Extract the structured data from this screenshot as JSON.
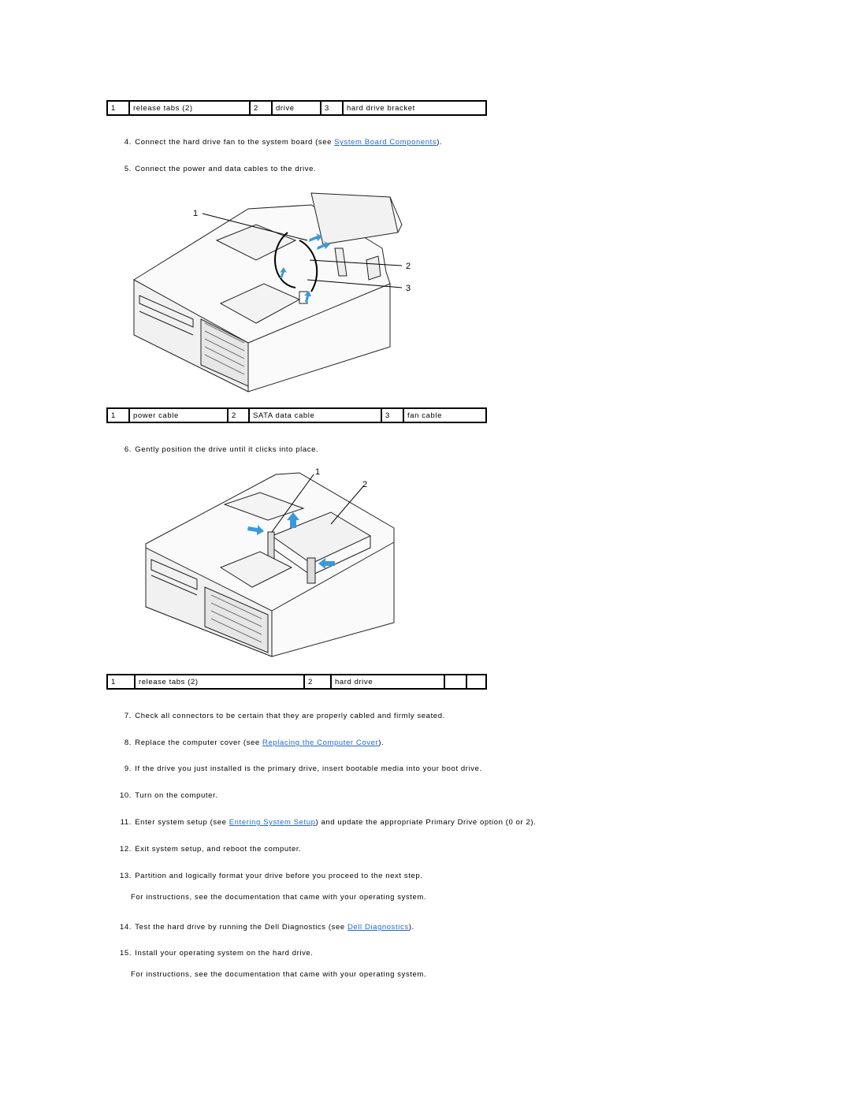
{
  "tables": [
    {
      "rows": [
        [
          "1",
          "release tabs (2)",
          "2",
          "drive",
          "3",
          "hard drive bracket"
        ]
      ]
    },
    {
      "rows": [
        [
          "1",
          "power cable",
          "2",
          "SATA data cable",
          "3",
          "fan cable"
        ]
      ]
    },
    {
      "rows": [
        [
          "1",
          "release tabs (2)",
          "2",
          "hard drive",
          "",
          ""
        ]
      ]
    }
  ],
  "steps": [
    {
      "num": "4.",
      "before": "Connect the hard drive fan to the system board (see ",
      "link": "System Board Components",
      "after": ")."
    },
    {
      "num": "5.",
      "text": "Connect the power and data cables to the drive."
    },
    {
      "num": "6.",
      "text": "Gently position the drive until it clicks into place."
    },
    {
      "num": "7.",
      "text": "Check all connectors to be certain that they are properly cabled and firmly seated."
    },
    {
      "num": "8.",
      "before": "Replace the computer cover (see ",
      "link": "Replacing the Computer Cover",
      "after": ")."
    },
    {
      "num": "9.",
      "text": "If the drive you just installed is the primary drive, insert bootable media into your boot drive."
    },
    {
      "num": "10.",
      "text": "Turn on the computer."
    },
    {
      "num": "11.",
      "before": "Enter system setup (see ",
      "link": "Entering System Setup",
      "after": ") and update the appropriate Primary Drive option (0 or 2)."
    },
    {
      "num": "12.",
      "text": "Exit system setup, and reboot the computer."
    },
    {
      "num": "13.",
      "text": "Partition and logically format your drive before you proceed to the next step.",
      "sub": "For instructions, see the documentation that came with your operating system."
    },
    {
      "num": "14.",
      "before": "Test the hard drive by running the Dell Diagnostics (see ",
      "link": "Dell Diagnostics",
      "after": ")."
    },
    {
      "num": "15.",
      "text": "Install your operating system on the hard drive.",
      "sub": "For instructions, see the documentation that came with your operating system."
    }
  ],
  "figures": {
    "cables": {
      "callouts": [
        "1",
        "2",
        "3"
      ]
    },
    "position": {
      "callouts": [
        "1",
        "2"
      ]
    }
  },
  "colors": {
    "link": "#1f66d6",
    "arrow": "#3a9ad9"
  }
}
